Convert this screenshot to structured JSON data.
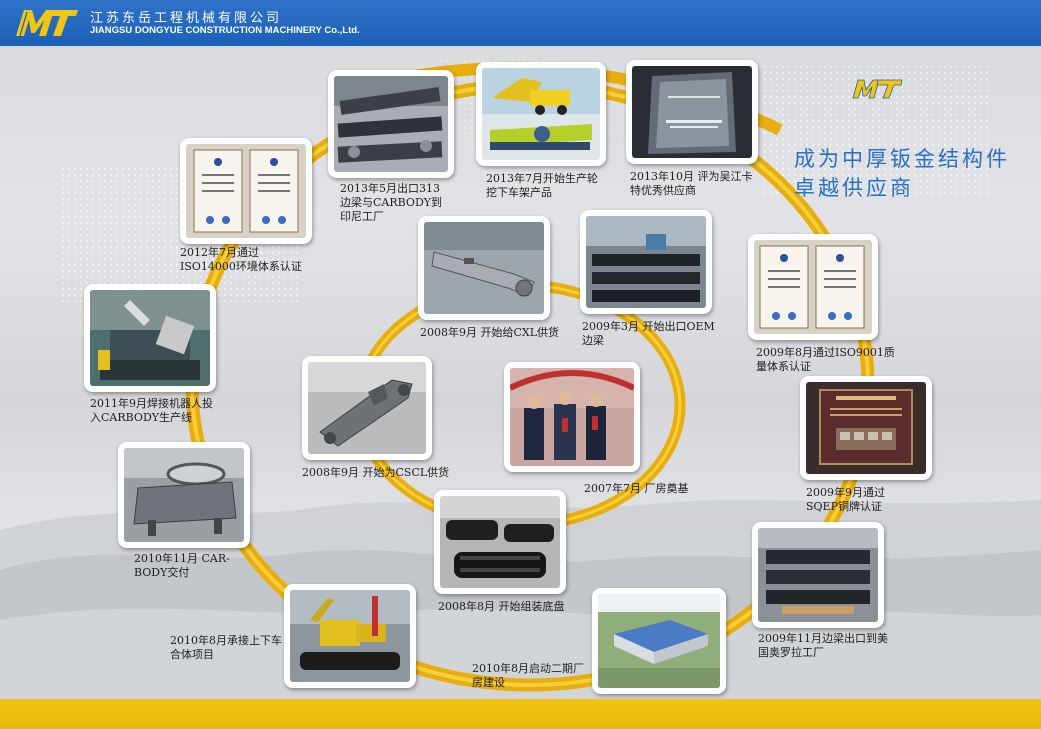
{
  "header": {
    "logo_text": "MT",
    "company_cn": "江苏东岳工程机械有限公司",
    "company_en": "JIANGSU DONGYUE CONSTRUCTION MACHINERY Co.,Ltd."
  },
  "slogan": {
    "line1": "成为中厚钣金结构件",
    "line2": "卓越供应商",
    "mark": "MT"
  },
  "milestones": [
    {
      "id": "m1",
      "caption": "2013年5月出口313边梁与CARBODY到印尼工厂",
      "photo": "side-beam-parts"
    },
    {
      "id": "m2",
      "caption": "2013年7月开始生产轮挖下车架产品",
      "photo": "wheeled-excavator-undercarriage"
    },
    {
      "id": "m3",
      "caption": "2013年10月 评为吴江卡特优秀供应商",
      "photo": "excellent-supplier-award"
    },
    {
      "id": "m4",
      "caption": "2012年7月通过ISO14000环境体系认证",
      "photo": "iso14000-certificates"
    },
    {
      "id": "m5",
      "caption": "2008年9月 开始给CXL供货",
      "photo": "cxl-boom-part"
    },
    {
      "id": "m6",
      "caption": "2009年3月 开始出口OEM边梁",
      "photo": "oem-side-beams"
    },
    {
      "id": "m7",
      "caption": "2009年8月通过ISO9001质量体系认证",
      "photo": "iso9001-certificates"
    },
    {
      "id": "m8",
      "caption": "2011年9月焊接机器人投入CARBODY生产线",
      "photo": "welding-robot"
    },
    {
      "id": "m9",
      "caption": "2008年9月 开始为CSCL供货",
      "photo": "cscl-part"
    },
    {
      "id": "m10",
      "caption": "2007年7月 厂房奠基",
      "photo": "groundbreaking-ceremony"
    },
    {
      "id": "m11",
      "caption": "2009年9月通过SQEP铜牌认证",
      "photo": "sqep-bronze-plaque"
    },
    {
      "id": "m12",
      "caption": "2010年11月 CAR-BODY交付",
      "photo": "carbody-delivery"
    },
    {
      "id": "m13",
      "caption": "2008年8月 开始组装底盘",
      "photo": "chassis-assembly"
    },
    {
      "id": "m14",
      "caption": "2010年8月承接上下车合体项目",
      "photo": "upper-lower-assembly"
    },
    {
      "id": "m15",
      "caption": "2010年8月启动二期厂房建设",
      "photo": "phase-two-plant"
    },
    {
      "id": "m16",
      "caption": "2009年11月边梁出口到美国奥罗拉工厂",
      "photo": "side-beams-export-usa"
    }
  ],
  "colors": {
    "header_blue": "#1c5fb7",
    "ring_gold": "#e8ad0e",
    "bottom_yellow": "#f2c511",
    "slogan_blue": "#2a6fc7"
  }
}
